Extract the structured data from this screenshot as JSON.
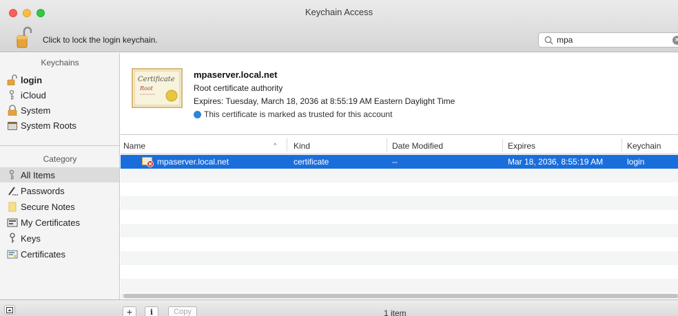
{
  "window": {
    "title": "Keychain Access"
  },
  "toolbar": {
    "lock_text": "Click to lock the login keychain."
  },
  "search": {
    "value": "mpa",
    "clear_glyph": "×"
  },
  "sidebar": {
    "keychains_header": "Keychains",
    "keychains": [
      {
        "label": "login",
        "icon": "unlocked-padlock-icon"
      },
      {
        "label": "iCloud",
        "icon": "icloud-keychain-icon"
      },
      {
        "label": "System",
        "icon": "padlock-icon"
      },
      {
        "label": "System Roots",
        "icon": "folder-icon"
      }
    ],
    "category_header": "Category",
    "categories": [
      {
        "label": "All Items",
        "icon": "all-items-icon",
        "selected": true
      },
      {
        "label": "Passwords",
        "icon": "passwords-icon"
      },
      {
        "label": "Secure Notes",
        "icon": "secure-note-icon"
      },
      {
        "label": "My Certificates",
        "icon": "my-certificates-icon"
      },
      {
        "label": "Keys",
        "icon": "key-icon"
      },
      {
        "label": "Certificates",
        "icon": "certificate-icon"
      }
    ]
  },
  "details": {
    "name": "mpaserver.local.net",
    "type": "Root certificate authority",
    "expires": "Expires: Tuesday, March 18, 2036 at 8:55:19 AM Eastern Daylight Time",
    "trust": "This certificate is marked as trusted for this account",
    "cert_image_text_1": "Certificate",
    "cert_image_text_2": "Root"
  },
  "table": {
    "columns": [
      "Name",
      "Kind",
      "Date Modified",
      "Expires",
      "Keychain"
    ],
    "sort_glyph": "^",
    "rows": [
      {
        "name": "mpaserver.local.net",
        "kind": "certificate",
        "date_modified": "--",
        "expires": "Mar 18, 2036, 8:55:19 AM",
        "keychain": "login"
      }
    ]
  },
  "bottombar": {
    "add_label": "+",
    "info_label": "i",
    "copy_label": "Copy",
    "item_count": "1 item"
  },
  "colors": {
    "selection": "#1a6edc",
    "accent": "#2e84d8"
  }
}
